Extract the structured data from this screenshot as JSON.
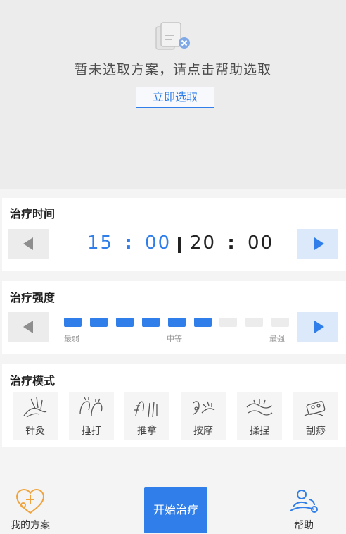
{
  "empty_state": {
    "message": "暂未选取方案，请点击帮助选取",
    "select_button": "立即选取"
  },
  "treatment_time": {
    "title": "治疗时间",
    "current_minutes": "15",
    "current_seconds": "00",
    "total_minutes": "20",
    "total_seconds": "00",
    "colon": ":"
  },
  "treatment_intensity": {
    "title": "治疗强度",
    "level": 6,
    "max_level": 9,
    "label_min": "最弱",
    "label_mid": "中等",
    "label_max": "最强"
  },
  "treatment_mode": {
    "title": "治疗模式",
    "modes": [
      {
        "label": "针灸",
        "icon": "acupuncture-icon"
      },
      {
        "label": "捶打",
        "icon": "pounding-icon"
      },
      {
        "label": "推拿",
        "icon": "tuina-icon"
      },
      {
        "label": "按摩",
        "icon": "massage-icon"
      },
      {
        "label": "揉捏",
        "icon": "kneading-icon"
      },
      {
        "label": "刮痧",
        "icon": "guasha-icon"
      }
    ]
  },
  "bottom_nav": {
    "my_plan": "我的方案",
    "start": "开始治疗",
    "help": "帮助"
  },
  "colors": {
    "accent": "#2f7ee9",
    "accent_light": "#dbe9fb",
    "inactive_segment": "#ececec",
    "plan_icon": "#f0a33c"
  }
}
